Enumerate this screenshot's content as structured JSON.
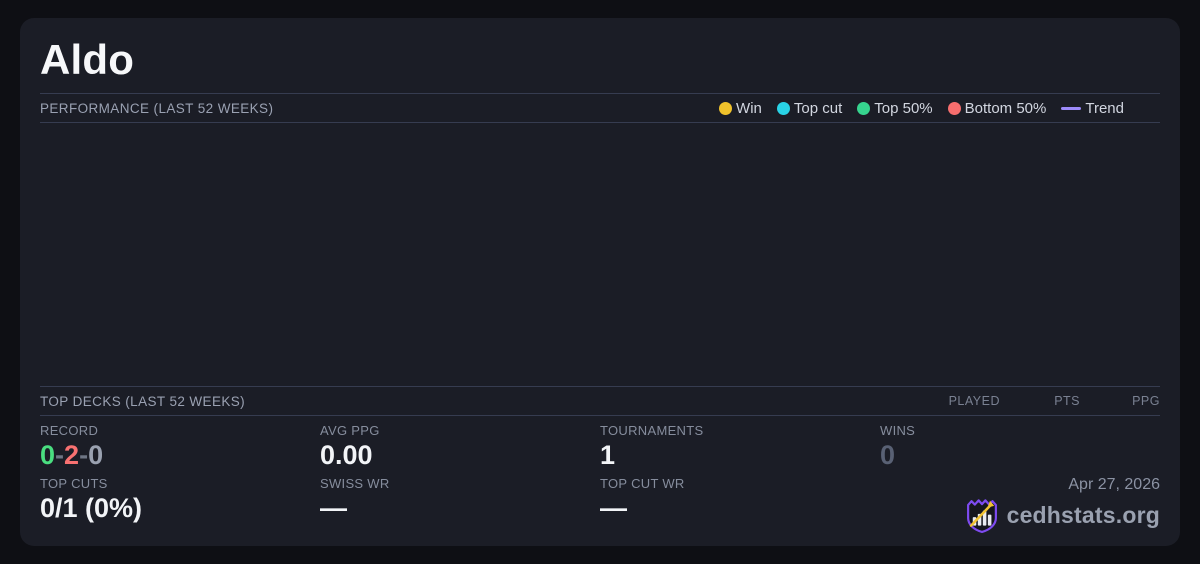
{
  "colors": {
    "win": "#f0c22b",
    "top_cut": "#29d3e6",
    "top_50": "#36d48e",
    "bottom_50": "#f76e6e",
    "trend": "#9d8bfa",
    "record_win": "#4ade80",
    "record_loss": "#f87171",
    "record_draw": "#9aa1b0"
  },
  "card": {
    "title": "Aldo",
    "performance": {
      "heading": "PERFORMANCE (LAST 52 WEEKS)",
      "legend": [
        {
          "label": "Win"
        },
        {
          "label": "Top cut"
        },
        {
          "label": "Top 50%"
        },
        {
          "label": "Bottom 50%"
        },
        {
          "label": "Trend"
        }
      ]
    },
    "top_decks": {
      "heading": "TOP DECKS (LAST 52 WEEKS)",
      "columns": [
        "PLAYED",
        "PTS",
        "PPG"
      ]
    },
    "stats": {
      "record": {
        "label": "RECORD",
        "wins": "0",
        "losses": "2",
        "draws": "0",
        "separator": "-"
      },
      "avg_ppg": {
        "label": "AVG PPG",
        "value": "0.00"
      },
      "tournaments": {
        "label": "TOURNAMENTS",
        "value": "1"
      },
      "wins": {
        "label": "WINS",
        "value": "0"
      },
      "top_cuts": {
        "label": "TOP CUTS",
        "value": "0/1 (0%)"
      },
      "swiss_wr": {
        "label": "SWISS WR",
        "value": "—"
      },
      "top_cut_wr": {
        "label": "TOP CUT WR",
        "value": "—"
      }
    },
    "footer": {
      "date": "Apr 27, 2026",
      "brand": "cedhstats.org"
    }
  }
}
